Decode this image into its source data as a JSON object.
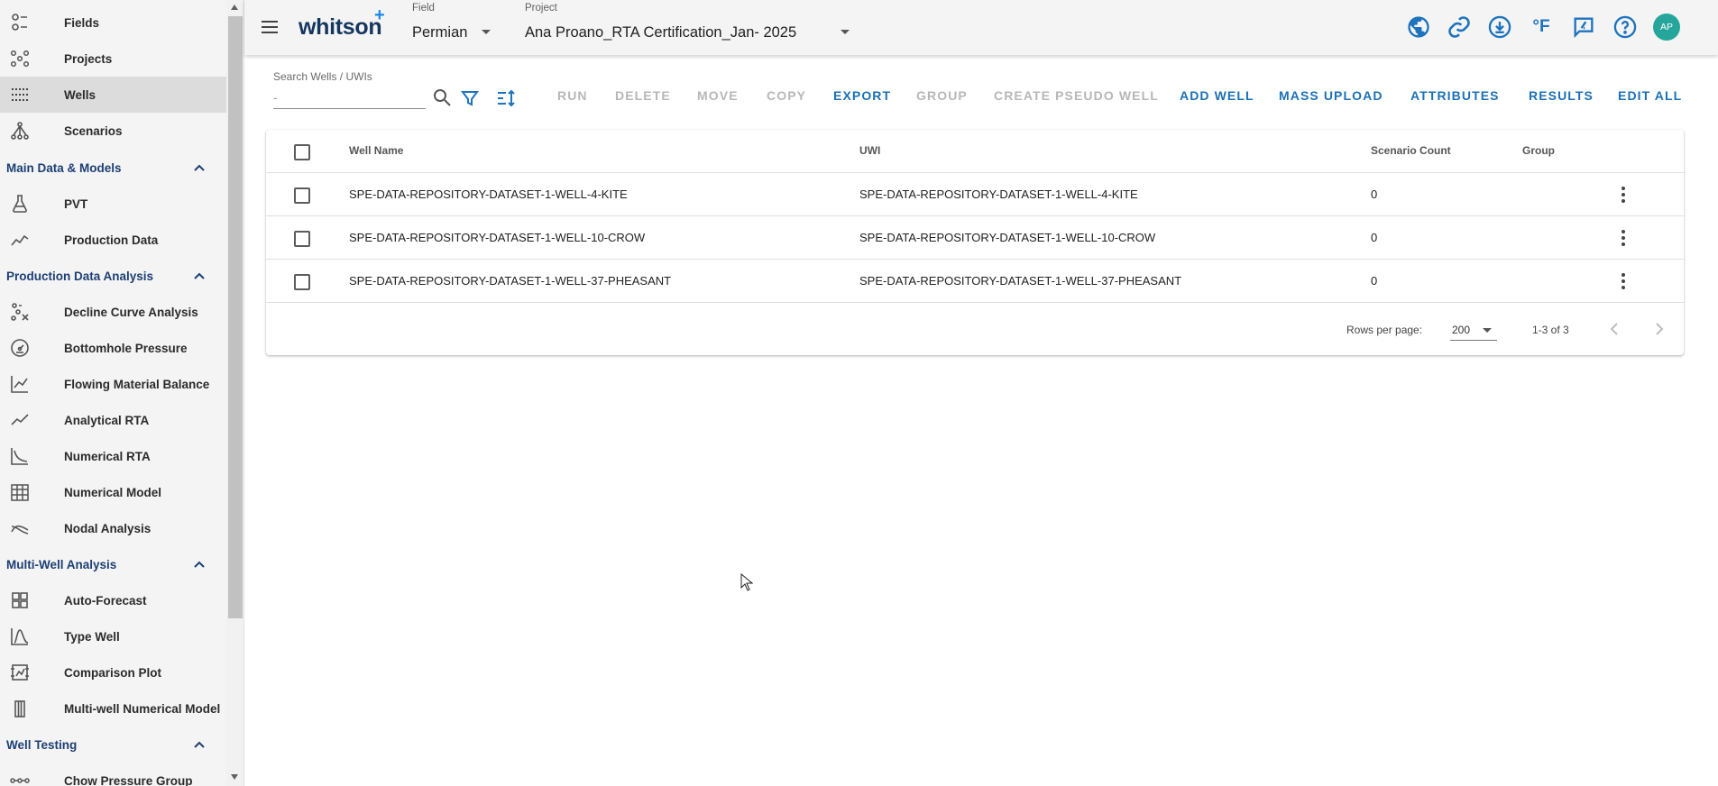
{
  "sidebar": {
    "items": [
      {
        "label": "Fields",
        "icon": "fields-icon"
      },
      {
        "label": "Projects",
        "icon": "projects-icon"
      },
      {
        "label": "Wells",
        "icon": "wells-icon",
        "active": true
      },
      {
        "label": "Scenarios",
        "icon": "scenarios-icon"
      }
    ],
    "sections": [
      {
        "title": "Main Data & Models",
        "items": [
          {
            "label": "PVT",
            "icon": "flask-icon"
          },
          {
            "label": "Production Data",
            "icon": "production-data-icon"
          }
        ]
      },
      {
        "title": "Production Data Analysis",
        "items": [
          {
            "label": "Decline Curve Analysis",
            "icon": "decline-curve-icon"
          },
          {
            "label": "Bottomhole Pressure",
            "icon": "gauge-icon"
          },
          {
            "label": "Flowing Material Balance",
            "icon": "chart-axes-icon"
          },
          {
            "label": "Analytical RTA",
            "icon": "trend-line-icon"
          },
          {
            "label": "Numerical RTA",
            "icon": "decline-axes-icon"
          },
          {
            "label": "Numerical Model",
            "icon": "grid-building-icon"
          },
          {
            "label": "Nodal Analysis",
            "icon": "nodal-curves-icon"
          }
        ]
      },
      {
        "title": "Multi-Well Analysis",
        "items": [
          {
            "label": "Auto-Forecast",
            "icon": "dashboard-grid-icon"
          },
          {
            "label": "Type Well",
            "icon": "bell-curve-icon"
          },
          {
            "label": "Comparison Plot",
            "icon": "comparison-plot-icon"
          },
          {
            "label": "Multi-well Numerical Model",
            "icon": "columns-icon"
          }
        ]
      },
      {
        "title": "Well Testing",
        "items": [
          {
            "label": "Chow Pressure Group",
            "icon": "chain-nodes-icon"
          }
        ]
      }
    ]
  },
  "header": {
    "logo_text": "whitson",
    "logo_plus": "+",
    "field": {
      "label": "Field",
      "value": "Permian"
    },
    "project": {
      "label": "Project",
      "value": "Ana Proano_RTA Certification_Jan- 2025"
    },
    "temperature_unit": "°F",
    "avatar_initials": "AP",
    "icons": [
      "globe-icon",
      "link-icon",
      "download-icon",
      "temperature-unit-icon",
      "feedback-icon",
      "help-icon"
    ]
  },
  "toolbar": {
    "search_label": "Search Wells / UWIs",
    "search_placeholder": "-",
    "buttons": {
      "run": "RUN",
      "delete": "DELETE",
      "move": "MOVE",
      "copy": "COPY",
      "export": "EXPORT",
      "group": "GROUP",
      "create_pseudo": "CREATE PSEUDO WELL",
      "add_well": "ADD WELL",
      "mass_upload": "MASS UPLOAD",
      "attributes": "ATTRIBUTES",
      "results": "RESULTS",
      "edit_all": "EDIT ALL"
    },
    "disabled_buttons": [
      "run",
      "delete",
      "move",
      "copy",
      "group",
      "create_pseudo"
    ]
  },
  "table": {
    "columns": [
      "Well Name",
      "UWI",
      "Scenario Count",
      "Group"
    ],
    "rows": [
      {
        "well_name": "SPE-DATA-REPOSITORY-DATASET-1-WELL-4-KITE",
        "uwi": "SPE-DATA-REPOSITORY-DATASET-1-WELL-4-KITE",
        "scenario_count": "0",
        "group": ""
      },
      {
        "well_name": "SPE-DATA-REPOSITORY-DATASET-1-WELL-10-CROW",
        "uwi": "SPE-DATA-REPOSITORY-DATASET-1-WELL-10-CROW",
        "scenario_count": "0",
        "group": ""
      },
      {
        "well_name": "SPE-DATA-REPOSITORY-DATASET-1-WELL-37-PHEASANT",
        "uwi": "SPE-DATA-REPOSITORY-DATASET-1-WELL-37-PHEASANT",
        "scenario_count": "0",
        "group": ""
      }
    ],
    "footer": {
      "rows_per_page_label": "Rows per page:",
      "rows_per_page_value": "200",
      "range_text": "1-3 of 3"
    }
  },
  "colors": {
    "brand_navy": "#14365f",
    "accent_blue": "#1c70b6",
    "section_title": "#1c3f74",
    "avatar_bg": "#26a69a",
    "disabled_text": "#b7b7b7"
  }
}
